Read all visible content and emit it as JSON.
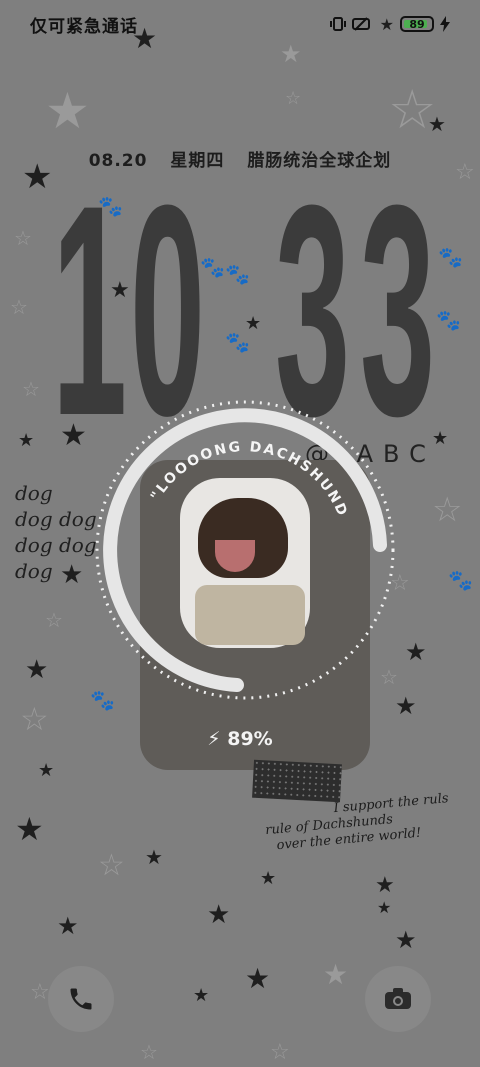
{
  "status_bar": {
    "left_text": "仅可紧急通话",
    "battery_level": "89"
  },
  "lock": {
    "date": "08.20",
    "weekday": "星期四",
    "note": "腊肠统治全球企划",
    "clock_digits": [
      "1",
      "0",
      "3",
      "3"
    ],
    "abc": "ABC",
    "ring_text": "\"LOOOONG DACHSHUND\"",
    "charge_percent": "89%",
    "quote_lines": [
      "I support the ruls",
      "rule of Dachshunds",
      "over the entire world!"
    ],
    "dog_words": [
      "dog",
      "dog dog",
      "dog dog",
      "dog"
    ]
  },
  "colors": {
    "accent": "#4caf50",
    "text_dark": "#1d1d1d",
    "background": "#7f7f7f"
  },
  "icons": [
    "phone-icon",
    "camera-icon"
  ]
}
